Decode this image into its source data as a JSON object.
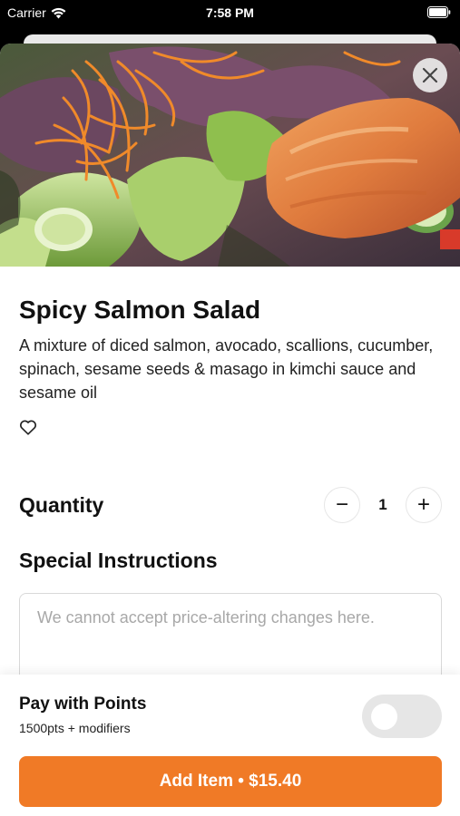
{
  "status_bar": {
    "carrier": "Carrier",
    "time": "7:58 PM"
  },
  "item": {
    "title": "Spicy Salmon Salad",
    "description": "A mixture of diced salmon, avocado, scallions, cucumber, spinach, sesame seeds & masago in kimchi sauce and sesame oil",
    "favorite_icon": "heart-outline-icon"
  },
  "quantity": {
    "label": "Quantity",
    "value": "1",
    "decrement": "−",
    "increment": "+"
  },
  "special_instructions": {
    "label": "Special Instructions",
    "placeholder": "We cannot accept price-altering changes here."
  },
  "points": {
    "title": "Pay with Points",
    "subtitle": "1500pts + modifiers",
    "enabled": false
  },
  "cta": {
    "label": "Add Item • $15.40"
  },
  "colors": {
    "accent": "#f07a26"
  }
}
